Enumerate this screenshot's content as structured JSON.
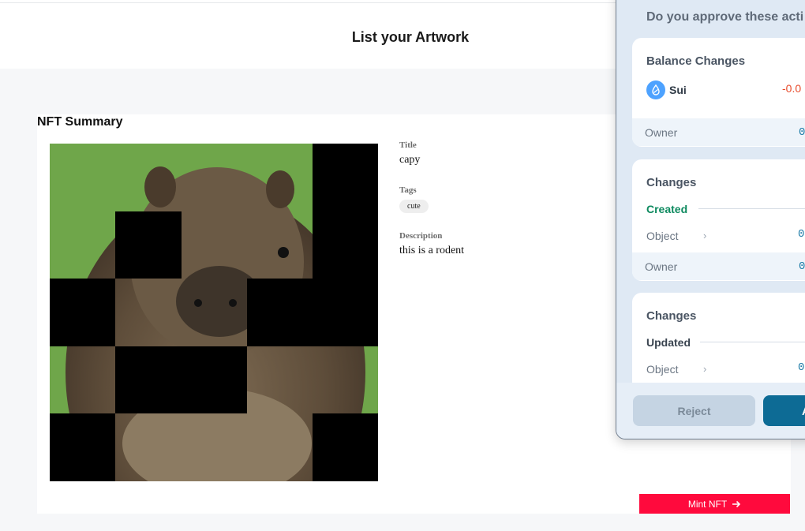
{
  "header": {
    "title": "List your Artwork"
  },
  "summary": {
    "heading": "NFT Summary",
    "image_alt": "capybara",
    "title_label": "Title",
    "title_value": "capy",
    "tags_label": "Tags",
    "tags": [
      "cute"
    ],
    "description_label": "Description",
    "description_value": "this is a rodent",
    "mint_label": "Mint NFT"
  },
  "wallet_popup": {
    "question": "Do you approve these acti",
    "balance": {
      "title": "Balance Changes",
      "coin": "Sui",
      "amount": "-0.0",
      "owner_label": "Owner",
      "owner_value": "0"
    },
    "created": {
      "title": "Changes",
      "section": "Created",
      "object_label": "Object",
      "object_value": "0",
      "owner_label": "Owner",
      "owner_value": "0"
    },
    "updated": {
      "title": "Changes",
      "section": "Updated",
      "object_label": "Object",
      "object_value": "0"
    },
    "reject_label": "Reject",
    "approve_label": "A"
  },
  "colors": {
    "mint_button": "#ff0a3d",
    "created_green": "#0e8a5f",
    "negative_red": "#e84b2c",
    "approve_blue": "#0d6b95"
  }
}
